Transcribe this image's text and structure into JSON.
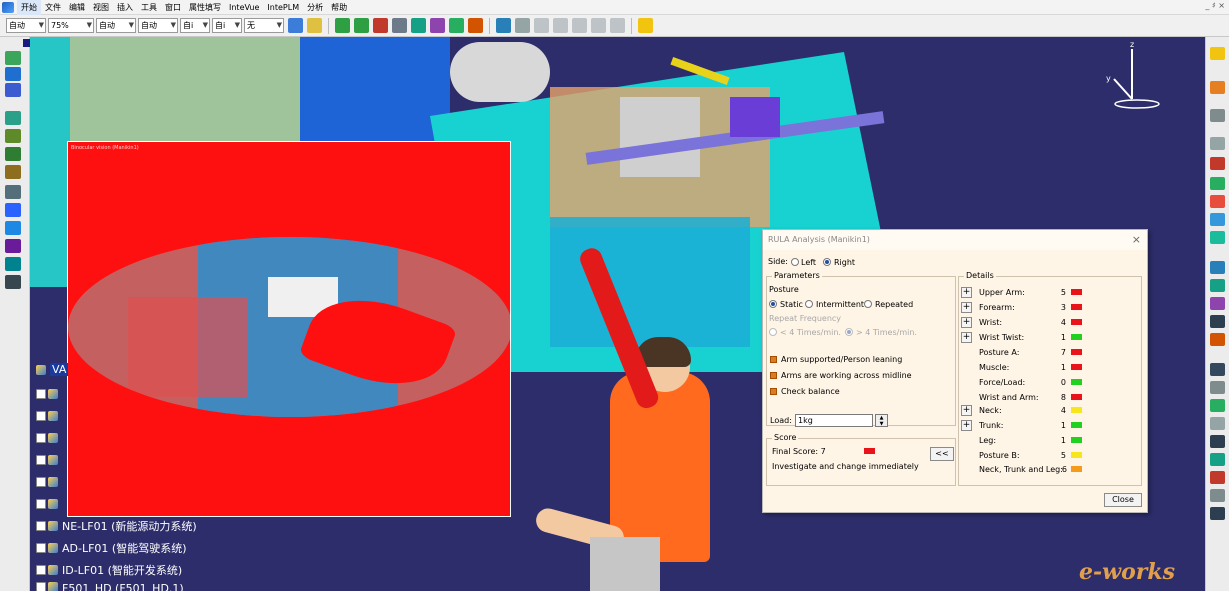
{
  "menubar": {
    "items": [
      "开始",
      "文件",
      "编辑",
      "视图",
      "插入",
      "工具",
      "窗口",
      "属性填写",
      "InteVue",
      "IntePLM",
      "分析",
      "帮助"
    ],
    "window_controls": "_ ♯ ×"
  },
  "toolbar": {
    "combo1": "自动",
    "zoom": "75%",
    "combo3": "自动",
    "combo4": "自动",
    "combo5": "自i",
    "combo6": "自i",
    "linetype": "无"
  },
  "vision_window": {
    "title": "Binocular vision (Manikin1)"
  },
  "tree": {
    "root_label": "VA",
    "nodes": [
      "NE-LF01 (新能源动力系统)",
      "AD-LF01 (智能驾驶系统)",
      "ID-LF01 (智能开发系统)",
      "F501_HD (F501_HD.1)"
    ]
  },
  "rula": {
    "title": "RULA Analysis (Manikin1)",
    "side_label": "Side:",
    "side_left": "Left",
    "side_right": "Right",
    "side_selected": "Right",
    "parameters_label": "Parameters",
    "posture_label": "Posture",
    "posture_options": [
      "Static",
      "Intermittent",
      "Repeated"
    ],
    "posture_selected": "Static",
    "repeat_freq_label": "Repeat Frequency",
    "repeat_options": [
      "< 4 Times/min.",
      "> 4 Times/min."
    ],
    "repeat_selected": "> 4 Times/min.",
    "checks": [
      "Arm supported/Person leaning",
      "Arms are working across midline",
      "Check balance"
    ],
    "load_label": "Load:",
    "load_value": "1kg",
    "score_label": "Score",
    "final_score_label": "Final Score: 7",
    "final_score_color": "#e8141a",
    "advice": "Investigate and change immediately",
    "collapse_button": "<<",
    "details_label": "Details",
    "details": [
      {
        "label": "Upper Arm:",
        "value": "5",
        "color": "#e8141a",
        "expandable": true
      },
      {
        "label": "Forearm:",
        "value": "3",
        "color": "#e8141a",
        "expandable": true
      },
      {
        "label": "Wrist:",
        "value": "4",
        "color": "#e8141a",
        "expandable": true
      },
      {
        "label": "Wrist Twist:",
        "value": "1",
        "color": "#22d11f",
        "expandable": true
      },
      {
        "label": "Posture A:",
        "value": "7",
        "color": "#e8141a",
        "expandable": false
      },
      {
        "label": "Muscle:",
        "value": "1",
        "color": "#e8141a",
        "expandable": false
      },
      {
        "label": "Force/Load:",
        "value": "0",
        "color": "#22d11f",
        "expandable": false
      },
      {
        "label": "Wrist and Arm:",
        "value": "8",
        "color": "#e8141a",
        "expandable": false
      },
      {
        "label": "Neck:",
        "value": "4",
        "color": "#f7e61a",
        "expandable": true
      },
      {
        "label": "Trunk:",
        "value": "1",
        "color": "#22d11f",
        "expandable": true
      },
      {
        "label": "Leg:",
        "value": "1",
        "color": "#22d11f",
        "expandable": false
      },
      {
        "label": "Posture B:",
        "value": "5",
        "color": "#f7e61a",
        "expandable": false
      },
      {
        "label": "Neck, Trunk and Leg:",
        "value": "6",
        "color": "#f59a1a",
        "expandable": false
      }
    ],
    "close_button": "Close"
  },
  "watermark": "e-works",
  "compass": {
    "axis_z": "z",
    "axis_y": "y"
  },
  "colors": {
    "accent_orange": "#e07b1a",
    "vision_red": "#ff1010",
    "viewport_bg": "#2d2d6b"
  }
}
